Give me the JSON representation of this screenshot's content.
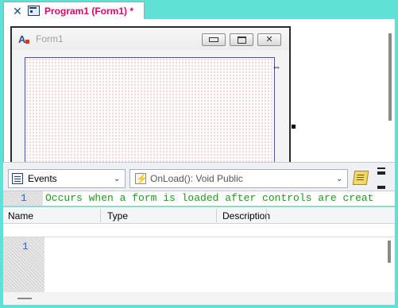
{
  "tab": {
    "title": "Program1 (Form1)  *",
    "close_glyph": "✕",
    "form_icon": "form-icon"
  },
  "designer": {
    "form_title": "Form1",
    "form_icon_glyph": "A",
    "buttons": {
      "minimize": "minimize-icon",
      "maximize": "maximize-icon",
      "close": "✕"
    },
    "resize_cursor": "⇔",
    "grid_dot_color": "#e07575"
  },
  "toolbar": {
    "events_label": "Events",
    "method_label": "OnLoad(): Void Public",
    "method_icon_glyph": "⚡",
    "chevron": "⌄"
  },
  "comment_line": {
    "line_number": "1",
    "text": "Occurs when a form is loaded after controls are creat"
  },
  "grid": {
    "columns": [
      "Name",
      "Type",
      "Description"
    ]
  },
  "editor": {
    "line_number": "1"
  },
  "colors": {
    "accent": "#5fe1d6",
    "tab_title": "#e0006a",
    "comment": "#1f9a1f",
    "line_number": "#2a64c8"
  }
}
